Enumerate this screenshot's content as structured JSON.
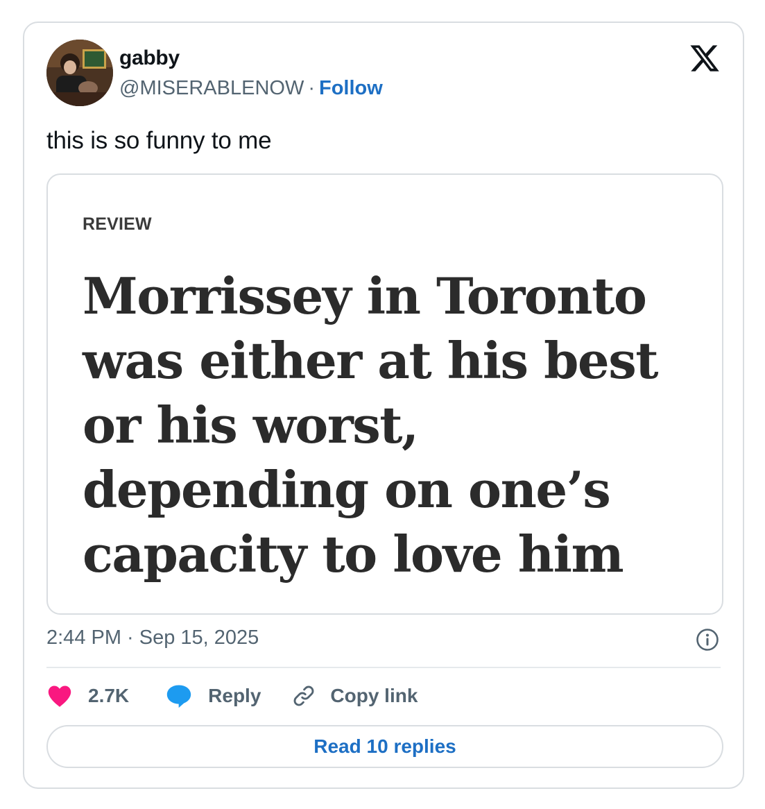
{
  "author": {
    "display_name": "gabby",
    "handle": "@MISERABLENOW",
    "separator": "·",
    "follow_label": "Follow"
  },
  "tweet": {
    "text": "this is so funny to me",
    "timestamp": "2:44 PM · Sep 15, 2025"
  },
  "media_card": {
    "section_label": "REVIEW",
    "headline": "Morrissey in Toronto was either at his best or his worst, depending on one’s capacity to love him"
  },
  "actions": {
    "like_count": "2.7K",
    "reply_label": "Reply",
    "copy_link_label": "Copy link"
  },
  "read_replies_label": "Read 10 replies",
  "icons": {
    "brand": "x-logo-icon",
    "info": "info-icon",
    "like": "heart-icon",
    "reply": "speech-bubble-icon",
    "copy": "link-icon"
  },
  "colors": {
    "link_blue": "#1d6fc4",
    "heart_pink": "#f91880",
    "reply_blue": "#1d9bf0",
    "secondary_text": "#536471",
    "border": "#d9dde1"
  }
}
